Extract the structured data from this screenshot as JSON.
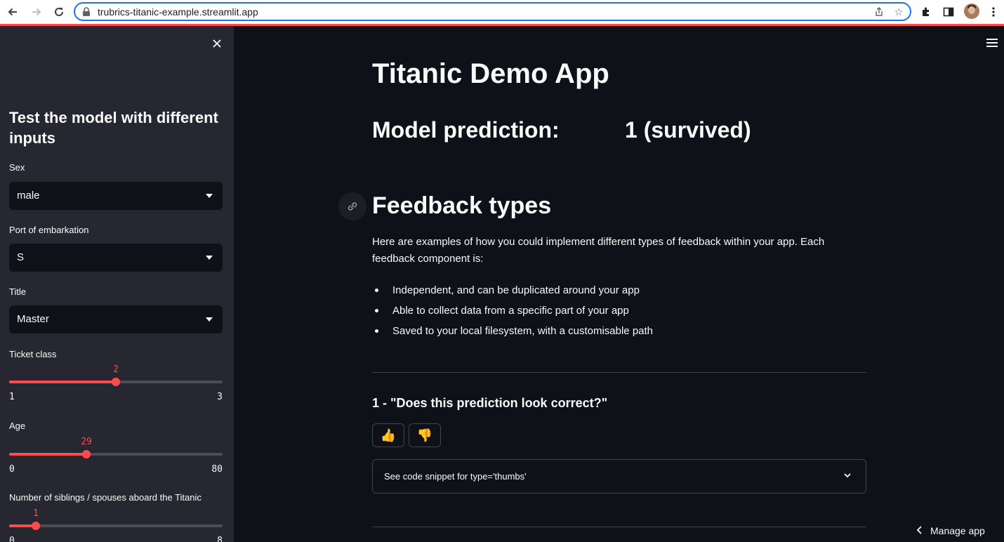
{
  "browser": {
    "url": "trubrics-titanic-example.streamlit.app"
  },
  "sidebar": {
    "title": "Test the model with different inputs",
    "sex": {
      "label": "Sex",
      "value": "male"
    },
    "port": {
      "label": "Port of embarkation",
      "value": "S"
    },
    "title_field": {
      "label": "Title",
      "value": "Master"
    },
    "ticket_class": {
      "label": "Ticket class",
      "value": "2",
      "min": "1",
      "max": "3",
      "fraction": 0.5
    },
    "age": {
      "label": "Age",
      "value": "29",
      "min": "0",
      "max": "80",
      "fraction": 0.3625
    },
    "siblings": {
      "label": "Number of siblings / spouses aboard the Titanic",
      "value": "1",
      "min": "0",
      "max": "8",
      "fraction": 0.125
    }
  },
  "main": {
    "title": "Titanic Demo App",
    "prediction_label": "Model prediction:",
    "prediction_value": "1 (survived)",
    "section_title": "Feedback types",
    "intro": "Here are examples of how you could implement different types of feedback within your app. Each feedback component is:",
    "bullets": [
      "Independent, and can be duplicated around your app",
      "Able to collect data from a specific part of your app",
      "Saved to your local filesystem, with a customisable path"
    ],
    "question": "1 - \"Does this prediction look correct?\"",
    "thumbs_up": "👍",
    "thumbs_down": "👎",
    "expander_label": "See code snippet for type='thumbs'",
    "manage_app": "Manage app"
  },
  "colors": {
    "accent": "#ff4b4b",
    "background": "#0e1117",
    "sidebar": "#262730"
  }
}
